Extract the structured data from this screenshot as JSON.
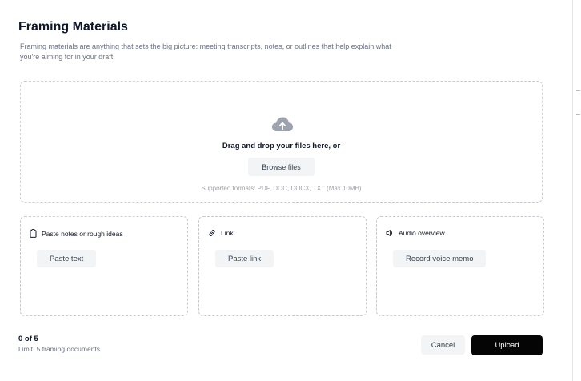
{
  "header": {
    "title": "Framing Materials",
    "description": "Framing materials are anything that sets the big picture: meeting transcripts, notes, or outlines that help explain what you're aiming for in your draft."
  },
  "dropzone": {
    "icon": "cloud-upload-icon",
    "prompt": "Drag and drop your files here, or",
    "browse_label": "Browse files",
    "formats": "Supported formats: PDF, DOC, DOCX, TXT (Max 10MB)"
  },
  "cards": [
    {
      "icon": "clipboard-icon",
      "title": "Paste notes or rough ideas",
      "button": "Paste text"
    },
    {
      "icon": "link-icon",
      "title": "Link",
      "button": "Paste link"
    },
    {
      "icon": "speaker-icon",
      "title": "Audio overview",
      "button": "Record voice memo"
    }
  ],
  "footer": {
    "count": "0 of 5",
    "limit": "Limit: 5 framing documents",
    "cancel_label": "Cancel",
    "upload_label": "Upload"
  },
  "colors": {
    "primary_button": "#050505",
    "secondary_button": "#f3f4f6",
    "dashed_border": "#c9cbd1",
    "icon_gray": "#9ca3af"
  }
}
